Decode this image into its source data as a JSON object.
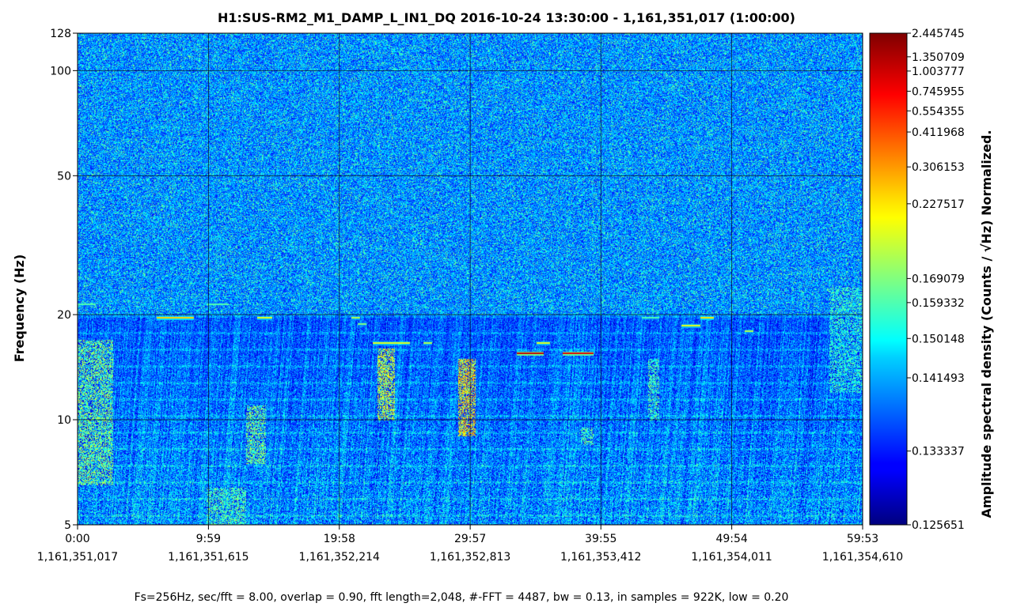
{
  "chart_data": {
    "type": "heatmap",
    "title": "H1:SUS-RM2_M1_DAMP_L_IN1_DQ 2016-10-24 13:30:00 - 1,161,351,017 (1:00:00)",
    "xlabel": "",
    "ylabel": "Frequency (Hz)",
    "colorbar_label": "Amplitude spectral density (Counts / √Hz) Normalized.",
    "footer": "Fs=256Hz, sec/fft = 8.00, overlap = 0.90, fft length=2,048, #-FFT = 4487, bw = 0.13, in samples = 922K, low = 0.20",
    "y_scale": "log",
    "ylim": [
      5,
      128
    ],
    "xlim_seconds": [
      0,
      3593
    ],
    "colormap": "jet",
    "grid": true,
    "x_ticks": [
      {
        "label": "0:00",
        "gps": "1,161,351,017",
        "seconds": 0
      },
      {
        "label": "9:59",
        "gps": "1,161,351,615",
        "seconds": 599
      },
      {
        "label": "19:58",
        "gps": "1,161,352,214",
        "seconds": 1198
      },
      {
        "label": "29:57",
        "gps": "1,161,352,813",
        "seconds": 1797
      },
      {
        "label": "39:55",
        "gps": "1,161,353,412",
        "seconds": 2395
      },
      {
        "label": "49:54",
        "gps": "1,161,354,011",
        "seconds": 2994
      },
      {
        "label": "59:53",
        "gps": "1,161,354,610",
        "seconds": 3593
      }
    ],
    "y_ticks": [
      5,
      10,
      20,
      50,
      100,
      128
    ],
    "colorbar_ticks": [
      {
        "label": "2.445745",
        "frac": 1.0
      },
      {
        "label": "1.350709",
        "frac": 0.952
      },
      {
        "label": "1.003777",
        "frac": 0.923
      },
      {
        "label": "0.745955",
        "frac": 0.882
      },
      {
        "label": "0.554355",
        "frac": 0.842
      },
      {
        "label": "0.411968",
        "frac": 0.799
      },
      {
        "label": "0.306153",
        "frac": 0.728
      },
      {
        "label": "0.227517",
        "frac": 0.653
      },
      {
        "label": "0.169079",
        "frac": 0.501
      },
      {
        "label": "0.159332",
        "frac": 0.452
      },
      {
        "label": "0.150148",
        "frac": 0.379
      },
      {
        "label": "0.141493",
        "frac": 0.299
      },
      {
        "label": "0.133337",
        "frac": 0.15
      },
      {
        "label": "0.125651",
        "frac": 0.0
      }
    ],
    "features": [
      {
        "kind": "line",
        "t_start": 0,
        "t_end": 80,
        "freq": 21.5,
        "level": 0.4
      },
      {
        "kind": "line",
        "t_start": 360,
        "t_end": 530,
        "freq": 19.6,
        "level": 0.62
      },
      {
        "kind": "line",
        "t_start": 590,
        "t_end": 690,
        "freq": 21.5,
        "level": 0.4
      },
      {
        "kind": "line",
        "t_start": 820,
        "t_end": 890,
        "freq": 19.6,
        "level": 0.55
      },
      {
        "kind": "line",
        "t_start": 1250,
        "t_end": 1290,
        "freq": 19.6,
        "level": 0.5
      },
      {
        "kind": "line",
        "t_start": 1280,
        "t_end": 1320,
        "freq": 18.8,
        "level": 0.45
      },
      {
        "kind": "line",
        "t_start": 1350,
        "t_end": 1520,
        "freq": 16.6,
        "level": 0.55
      },
      {
        "kind": "line",
        "t_start": 1580,
        "t_end": 1620,
        "freq": 16.6,
        "level": 0.5
      },
      {
        "kind": "line",
        "t_start": 2010,
        "t_end": 2130,
        "freq": 15.5,
        "level": 0.88
      },
      {
        "kind": "line",
        "t_start": 2100,
        "t_end": 2160,
        "freq": 16.6,
        "level": 0.55
      },
      {
        "kind": "line",
        "t_start": 2220,
        "t_end": 2360,
        "freq": 15.5,
        "level": 0.85
      },
      {
        "kind": "line",
        "t_start": 2580,
        "t_end": 2660,
        "freq": 19.6,
        "level": 0.4
      },
      {
        "kind": "line",
        "t_start": 2760,
        "t_end": 2850,
        "freq": 18.6,
        "level": 0.55
      },
      {
        "kind": "line",
        "t_start": 2850,
        "t_end": 2910,
        "freq": 19.6,
        "level": 0.6
      },
      {
        "kind": "line",
        "t_start": 3050,
        "t_end": 3090,
        "freq": 18.0,
        "level": 0.5
      },
      {
        "kind": "blob",
        "t_start": 0,
        "t_end": 160,
        "f_low": 6.5,
        "f_high": 17,
        "level": 0.6
      },
      {
        "kind": "blob",
        "t_start": 590,
        "t_end": 770,
        "f_low": 5,
        "f_high": 6.4,
        "level": 0.55
      },
      {
        "kind": "blob",
        "t_start": 770,
        "t_end": 860,
        "f_low": 7.5,
        "f_high": 11,
        "level": 0.6
      },
      {
        "kind": "blob",
        "t_start": 1370,
        "t_end": 1450,
        "f_low": 10,
        "f_high": 16,
        "level": 0.7
      },
      {
        "kind": "blob",
        "t_start": 1740,
        "t_end": 1820,
        "f_low": 9,
        "f_high": 15,
        "level": 0.78
      },
      {
        "kind": "blob",
        "t_start": 2300,
        "t_end": 2360,
        "f_low": 8.5,
        "f_high": 9.5,
        "level": 0.55
      },
      {
        "kind": "blob",
        "t_start": 2610,
        "t_end": 2660,
        "f_low": 10,
        "f_high": 15,
        "level": 0.55
      },
      {
        "kind": "blob",
        "t_start": 3440,
        "t_end": 3593,
        "f_low": 12,
        "f_high": 24,
        "level": 0.5
      }
    ]
  }
}
